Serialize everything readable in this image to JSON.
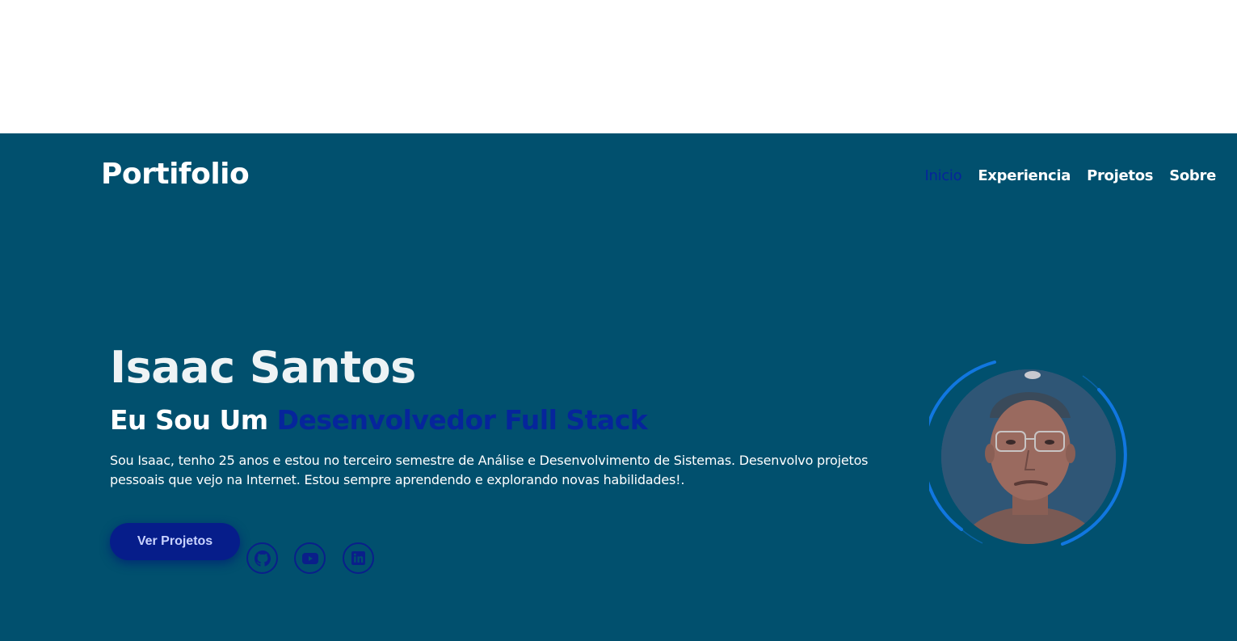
{
  "brand": "Portifolio",
  "nav": {
    "items": [
      {
        "label": "Inicio",
        "active": true
      },
      {
        "label": "Experiencia",
        "active": false
      },
      {
        "label": "Projetos",
        "active": false
      },
      {
        "label": "Sobre",
        "active": false
      }
    ]
  },
  "hero": {
    "name": "Isaac Santos",
    "role_prefix": "Eu Sou Um",
    "role_highlight": "Desenvolvedor Full Stack",
    "description": "Sou Isaac, tenho 25 anos e estou no terceiro semestre de Análise e Desenvolvimento de Sistemas. Desenvolvo projetos pessoais que vejo na Internet. Estou sempre aprendendo e explorando novas habilidades!.",
    "cta_label": "Ver Projetos"
  },
  "social": [
    {
      "icon": "github-icon"
    },
    {
      "icon": "youtube-icon"
    },
    {
      "icon": "linkedin-icon"
    }
  ],
  "colors": {
    "background": "#01506e",
    "accent": "#06259b",
    "ring": "#1177e0",
    "text": "#ffffff"
  }
}
